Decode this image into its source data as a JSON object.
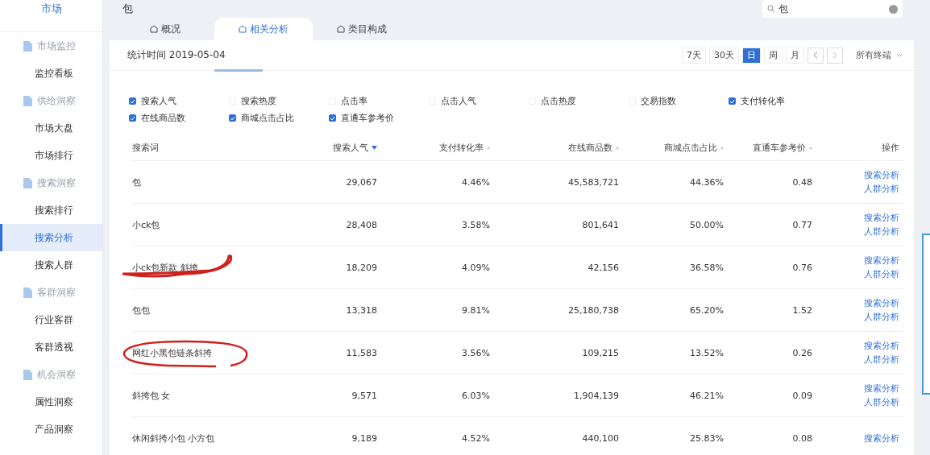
{
  "sidebar": {
    "header": "市场",
    "items": [
      {
        "label": "市场监控",
        "kind": "group",
        "selected": false
      },
      {
        "label": "监控看板",
        "kind": "item",
        "selected": false
      },
      {
        "label": "供给洞察",
        "kind": "group",
        "selected": false
      },
      {
        "label": "市场大盘",
        "kind": "item",
        "selected": false
      },
      {
        "label": "市场排行",
        "kind": "item",
        "selected": false
      },
      {
        "label": "搜索洞察",
        "kind": "group",
        "selected": false
      },
      {
        "label": "搜索排行",
        "kind": "item",
        "selected": false
      },
      {
        "label": "搜索分析",
        "kind": "item",
        "selected": true
      },
      {
        "label": "搜索人群",
        "kind": "item",
        "selected": false
      },
      {
        "label": "客群洞察",
        "kind": "group",
        "selected": false
      },
      {
        "label": "行业客群",
        "kind": "item",
        "selected": false
      },
      {
        "label": "客群透视",
        "kind": "item",
        "selected": false
      },
      {
        "label": "机会洞察",
        "kind": "group",
        "selected": false
      },
      {
        "label": "属性洞察",
        "kind": "item",
        "selected": false
      },
      {
        "label": "产品洞察",
        "kind": "item",
        "selected": false
      }
    ]
  },
  "page_title": "包",
  "search": {
    "value": "包"
  },
  "tabs": [
    {
      "label": "概况",
      "selected": false
    },
    {
      "label": "相关分析",
      "selected": true
    },
    {
      "label": "类目构成",
      "selected": false
    }
  ],
  "stats_time": "统计时间 2019-05-04",
  "periods": [
    {
      "label": "7天",
      "selected": false
    },
    {
      "label": "30天",
      "selected": false
    },
    {
      "label": "日",
      "selected": true
    },
    {
      "label": "周",
      "selected": false
    },
    {
      "label": "月",
      "selected": false
    }
  ],
  "device_select": "所有终端",
  "metrics": [
    {
      "label": "搜索人气",
      "checked": true
    },
    {
      "label": "搜索热度",
      "checked": false
    },
    {
      "label": "点击率",
      "checked": false
    },
    {
      "label": "点击人气",
      "checked": false
    },
    {
      "label": "点击热度",
      "checked": false
    },
    {
      "label": "交易指数",
      "checked": false
    },
    {
      "label": "支付转化率",
      "checked": true
    },
    {
      "label": "在线商品数",
      "checked": true
    },
    {
      "label": "商城点击占比",
      "checked": true
    },
    {
      "label": "直通车参考价",
      "checked": true
    }
  ],
  "table": {
    "columns": [
      {
        "label": "搜索词",
        "kind": "plain"
      },
      {
        "label": "搜索人气",
        "kind": "sortable",
        "sorted": true
      },
      {
        "label": "支付转化率",
        "kind": "sortable",
        "sorted": false
      },
      {
        "label": "在线商品数",
        "kind": "sortable",
        "sorted": false
      },
      {
        "label": "商城点击占比",
        "kind": "sortable",
        "sorted": false
      },
      {
        "label": "直通车参考价",
        "kind": "sortable",
        "sorted": false
      },
      {
        "label": "操作",
        "kind": "plain"
      }
    ],
    "rows": [
      {
        "kind": "plain",
        "cells": [
          "包",
          "29,067",
          "4.46%",
          "45,583,721",
          "44.36%",
          "0.48"
        ],
        "actions": [
          "搜索分析",
          "人群分析"
        ]
      },
      {
        "kind": "plain",
        "cells": [
          "小ck包",
          "28,408",
          "3.58%",
          "801,641",
          "50.00%",
          "0.77"
        ],
        "actions": [
          "搜索分析",
          "人群分析"
        ]
      },
      {
        "kind": "underlined",
        "cells": [
          "小ck包新款 斜挎",
          "18,209",
          "4.09%",
          "42,156",
          "36.58%",
          "0.76"
        ],
        "actions": [
          "搜索分析",
          "人群分析"
        ]
      },
      {
        "kind": "plain",
        "cells": [
          "包包",
          "13,318",
          "9.81%",
          "25,180,738",
          "65.20%",
          "1.52"
        ],
        "actions": [
          "搜索分析",
          "人群分析"
        ]
      },
      {
        "kind": "circled",
        "cells": [
          "网红小黑包链条斜挎",
          "11,583",
          "3.56%",
          "109,215",
          "13.52%",
          "0.26"
        ],
        "actions": [
          "搜索分析",
          "人群分析"
        ]
      },
      {
        "kind": "plain",
        "cells": [
          "斜挎包 女",
          "9,571",
          "6.03%",
          "1,904,139",
          "46.21%",
          "0.09"
        ],
        "actions": [
          "搜索分析",
          "人群分析"
        ]
      },
      {
        "kind": "plain",
        "cells": [
          "休闲斜挎小包 小方包",
          "9,189",
          "4.52%",
          "440,100",
          "25.83%",
          "0.08"
        ],
        "actions": [
          "搜索分析"
        ]
      }
    ]
  }
}
